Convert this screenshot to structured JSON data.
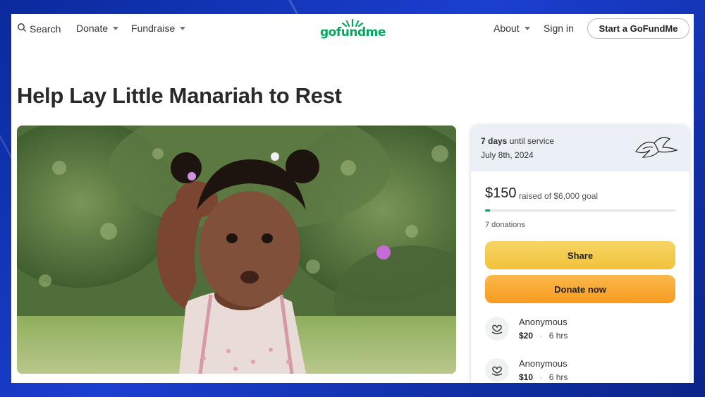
{
  "nav": {
    "search": "Search",
    "donate": "Donate",
    "fundraise": "Fundraise",
    "logo": "gofundme",
    "about": "About",
    "signin": "Sign in",
    "start": "Start a GoFundMe"
  },
  "campaign": {
    "title": "Help Lay Little Manariah to Rest"
  },
  "card": {
    "days_bold": "7 days",
    "days_rest": "until service",
    "date": "July 8th, 2024",
    "raised": "$150",
    "goal": "raised of $6,000 goal",
    "progress_fraction": 0.025,
    "donations": "7 donations",
    "share": "Share",
    "donate_now": "Donate now",
    "donors": [
      {
        "name": "Anonymous",
        "amount": "$20",
        "time": "6 hrs"
      },
      {
        "name": "Anonymous",
        "amount": "$10",
        "time": "6 hrs"
      }
    ]
  },
  "colors": {
    "brand_green": "#02a95c",
    "share_yellow": "#f2c23a",
    "donate_orange": "#f79b1f"
  },
  "icons": [
    "search-icon",
    "dove-icon",
    "donor-heart-icon"
  ]
}
